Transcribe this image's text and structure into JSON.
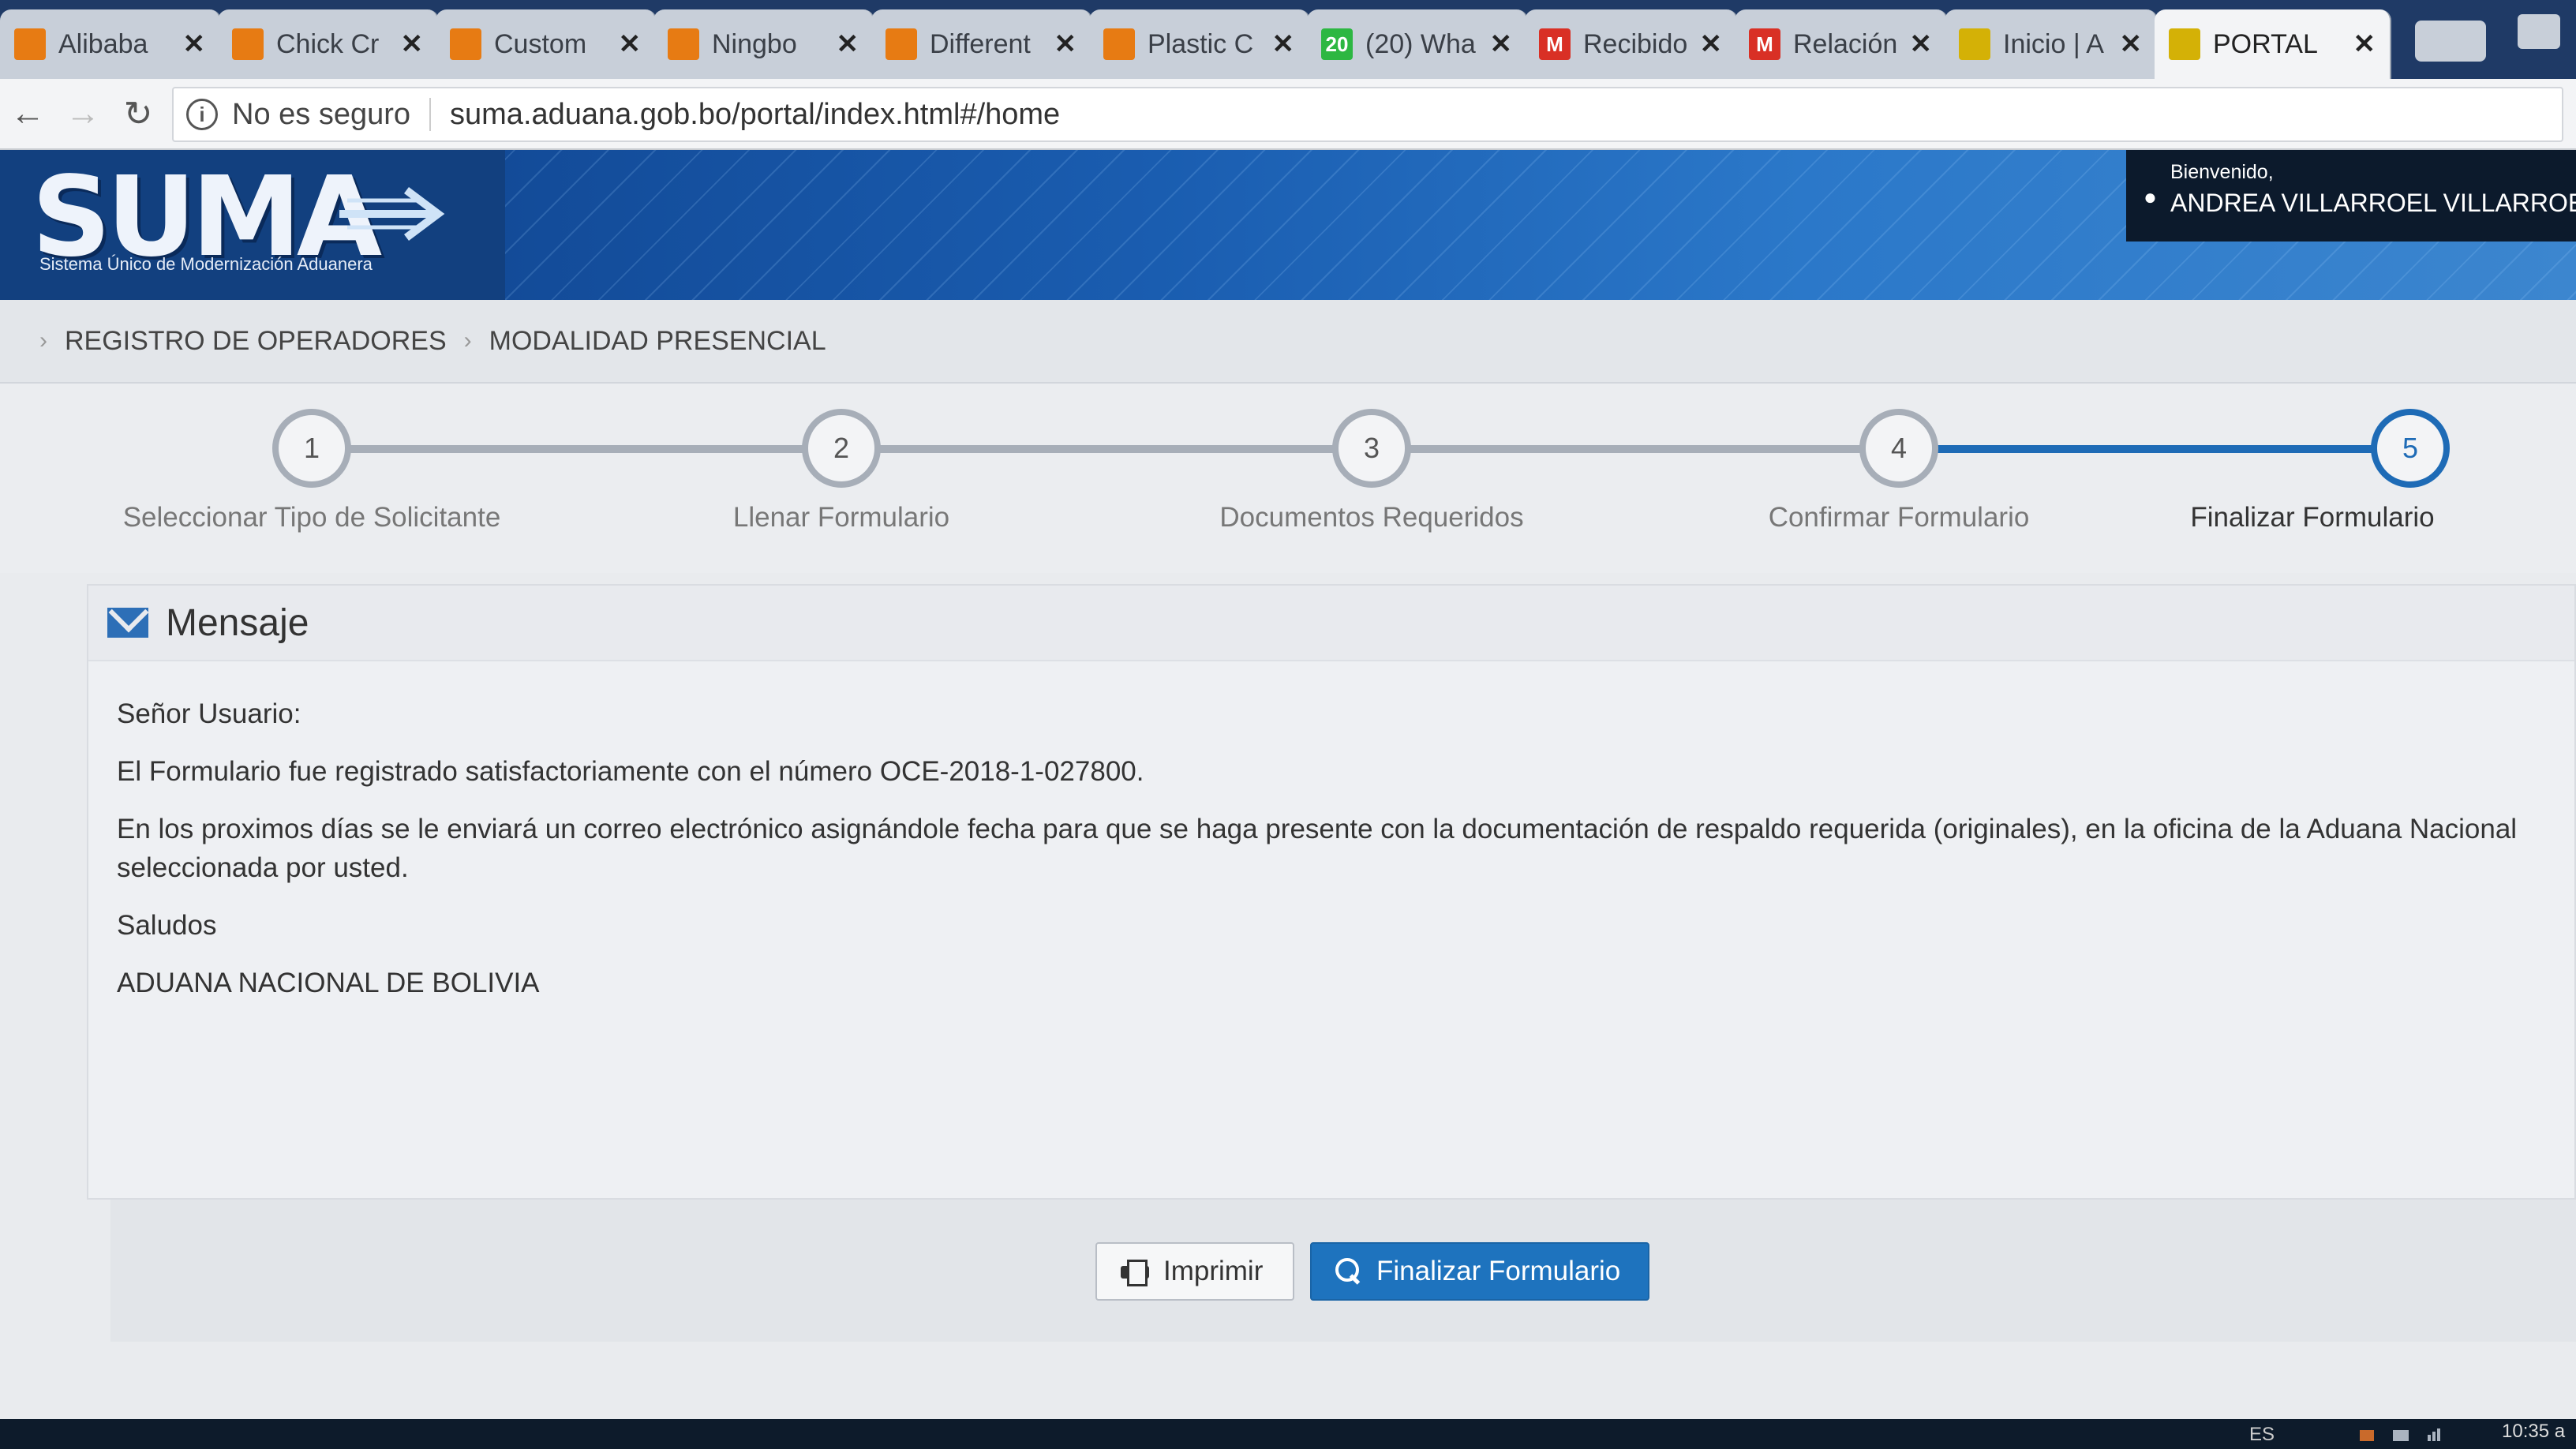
{
  "browser": {
    "tabs": [
      {
        "title": "Alibaba",
        "icon": "alibaba-icon",
        "icon_color": "#e77b13"
      },
      {
        "title": "Chick Cr",
        "icon": "alibaba-icon",
        "icon_color": "#e77b13"
      },
      {
        "title": "Custom",
        "icon": "alibaba-icon",
        "icon_color": "#e77b13"
      },
      {
        "title": "Ningbo",
        "icon": "alibaba-icon",
        "icon_color": "#e77b13"
      },
      {
        "title": "Different",
        "icon": "alibaba-icon",
        "icon_color": "#e77b13"
      },
      {
        "title": "Plastic C",
        "icon": "alibaba-icon",
        "icon_color": "#e77b13"
      },
      {
        "title": "(20) Wha",
        "icon": "whatsapp-icon",
        "icon_color": "#2db742",
        "icon_text": "20"
      },
      {
        "title": "Recibido",
        "icon": "gmail-icon",
        "icon_color": "#d93025",
        "icon_text": "M"
      },
      {
        "title": "Relación",
        "icon": "gmail-icon",
        "icon_color": "#d93025",
        "icon_text": "M"
      },
      {
        "title": "Inicio | A",
        "icon": "bolivia-flag-icon",
        "icon_color": "#d4b106"
      },
      {
        "title": "PORTAL",
        "icon": "bolivia-flag-icon",
        "icon_color": "#d4b106",
        "active": true
      }
    ],
    "close_glyph": "✕",
    "address": {
      "security_text": "No es seguro",
      "url": "suma.aduana.gob.bo/portal/index.html#/home"
    }
  },
  "header": {
    "logo_text": "SUMA",
    "logo_subtitle": "Sistema Único de Modernización Aduanera",
    "welcome_greeting": "Bienvenido,",
    "user_name": "ANDREA VILLARROEL VILLARROEL ()"
  },
  "breadcrumb": {
    "items": [
      "REGISTRO DE OPERADORES",
      "MODALIDAD PRESENCIAL"
    ]
  },
  "wizard": {
    "current_step": 5,
    "steps": [
      {
        "number": "1",
        "label": "Seleccionar Tipo de Solicitante"
      },
      {
        "number": "2",
        "label": "Llenar Formulario"
      },
      {
        "number": "3",
        "label": "Documentos Requeridos"
      },
      {
        "number": "4",
        "label": "Confirmar Formulario"
      },
      {
        "number": "5",
        "label": "Finalizar Formulario"
      }
    ],
    "active_color": "#1e6bb6",
    "inactive_color": "#a7aeb8"
  },
  "message": {
    "title": "Mensaje",
    "salutation": "Señor Usuario:",
    "line_registered": "El Formulario fue registrado satisfactoriamente con el número OCE-2018-1-027800.",
    "line_next_steps": "En los proximos días se le enviará un correo electrónico asignándole fecha para que se haga presente con la documentación de respaldo requerida (originales), en la oficina de la Aduana Nacional seleccionada por usted.",
    "closing": "Saludos",
    "signature": "ADUANA NACIONAL DE BOLIVIA"
  },
  "actions": {
    "print_label": "Imprimir",
    "finish_label": "Finalizar Formulario",
    "primary_color": "#1e73be"
  },
  "taskbar": {
    "language": "ES",
    "clock": "10:35 a"
  }
}
